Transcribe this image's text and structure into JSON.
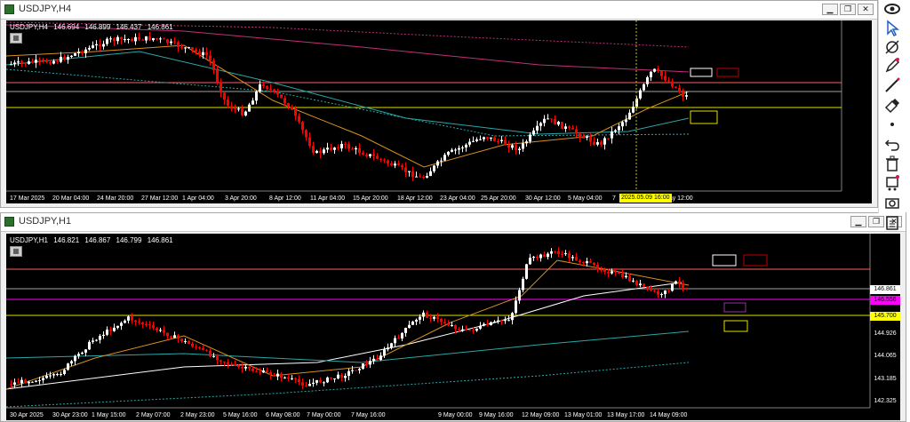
{
  "windows": {
    "h4": {
      "title": "USDJPY,H4",
      "symbol": "USDJPY,H4",
      "open": "146.694",
      "high": "146.899",
      "low": "146.437",
      "close": "146.861",
      "x_labels": [
        "17 Mar 2025",
        "20 Mar 04:00",
        "24 Mar 20:00",
        "27 Mar 12:00",
        "1 Apr 04:00",
        "3 Apr 20:00",
        "8 Apr 12:00",
        "11 Apr 04:00",
        "15 Apr 20:00",
        "18 Apr 12:00",
        "23 Apr 04:00",
        "25 Apr 20:00",
        "30 Apr 12:00",
        "5 May 04:00",
        "7",
        "May 12:00"
      ],
      "crosshair_label": "2025.05.09 16:00"
    },
    "h1": {
      "title": "USDJPY,H1",
      "symbol": "USDJPY,H1",
      "open": "146.821",
      "high": "146.867",
      "low": "146.799",
      "close": "146.861",
      "x_labels": [
        "30 Apr 2025",
        "30 Apr 23:00",
        "1 May 15:00",
        "2 May 07:00",
        "2 May 23:00",
        "5 May 16:00",
        "6 May 08:00",
        "7 May 00:00",
        "7 May 16:00",
        "9 May 00:00",
        "9 May 16:00",
        "12 May 09:00",
        "13 May 01:00",
        "13 May 17:00",
        "14 May 09:00"
      ],
      "y_labels": [
        "146.861",
        "146.556",
        "145.700",
        "144.926",
        "144.065",
        "143.185",
        "142.325"
      ],
      "price_tag_colors": {
        "current": "#ffffff",
        "magenta": "#ff00ff",
        "yellow": "#ffff00"
      }
    }
  },
  "window_buttons": {
    "minimize": "▁",
    "restore": "❐",
    "close": "✕"
  },
  "chart_icon": "▦",
  "toolbar": {
    "tools": [
      "eye-icon",
      "cursor-icon",
      "crosshair-icon",
      "pencil-icon",
      "line-icon",
      "eraser-icon",
      "dot-icon",
      "undo-icon",
      "trash-icon",
      "template-icon",
      "camera-icon",
      "clipboard-icon",
      "color-palette-icon"
    ]
  },
  "colors": {
    "chart_bg": "#000000",
    "bull": "#ffffff",
    "bear": "#ff0000",
    "ma_pink": "#c0307a",
    "ma_cyan": "#2aa8a8",
    "ma_orange": "#d89020",
    "level_red": "#ff6060",
    "level_yellow": "#e0e000",
    "level_magenta": "#ff00ff"
  }
}
